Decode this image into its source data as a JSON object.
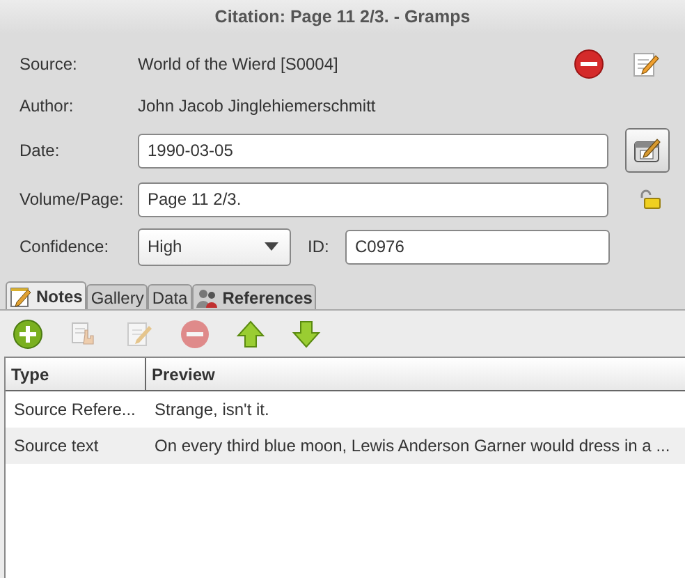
{
  "window": {
    "title": "Citation: Page 11 2/3. - Gramps"
  },
  "source": {
    "label": "Source:",
    "value": "World of the Wierd [S0004]"
  },
  "author": {
    "label": "Author:",
    "value": "John Jacob Jinglehiemerschmitt"
  },
  "date": {
    "label": "Date:",
    "value": "1990-03-05"
  },
  "volume": {
    "label": "Volume/Page:",
    "value": "Page 11 2/3.",
    "locked": false
  },
  "confidence": {
    "label": "Confidence:",
    "value": "High"
  },
  "id": {
    "label": "ID:",
    "value": "C0976"
  },
  "tabs": [
    {
      "label": "Notes",
      "selected": true,
      "bold": true,
      "kind": "note"
    },
    {
      "label": "Gallery",
      "selected": false,
      "bold": false
    },
    {
      "label": "Data",
      "selected": false,
      "bold": false
    },
    {
      "label": "References",
      "selected": false,
      "bold": true,
      "kind": "people"
    }
  ],
  "toolbar": [
    {
      "kind": "add",
      "disabled": false
    },
    {
      "kind": "share",
      "disabled": true
    },
    {
      "kind": "edit",
      "disabled": true
    },
    {
      "kind": "remove",
      "disabled": true
    },
    {
      "kind": "up",
      "disabled": false
    },
    {
      "kind": "down",
      "disabled": false
    }
  ],
  "table": {
    "columns": [
      "Type",
      "Preview"
    ],
    "rows": [
      [
        "Source Refere...",
        "Strange, isn't it."
      ],
      [
        "Source text",
        "On every third blue moon, Lewis Anderson Garner would dress in a ..."
      ]
    ]
  }
}
